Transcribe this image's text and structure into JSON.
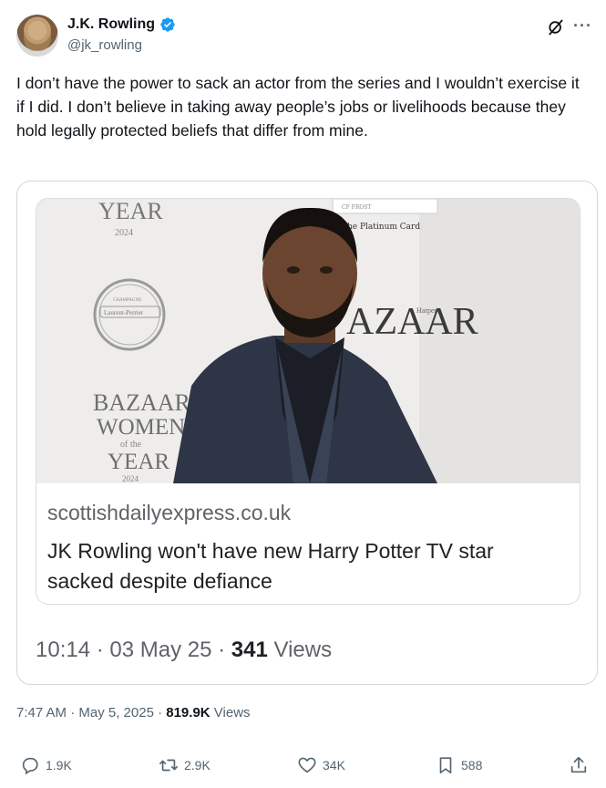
{
  "author": {
    "display_name": "J.K. Rowling",
    "handle": "@jk_rowling",
    "verified": true
  },
  "header_icons": [
    "grok-icon",
    "more-icon"
  ],
  "more_label": "···",
  "tweet": {
    "text": "I don’t have the power to sack an actor from the series and I wouldn’t exercise it if I did. I don’t believe in taking away people’s jobs or livelihoods because they hold legally protected beliefs that differ from mine."
  },
  "embedded": {
    "photo_text": {
      "year_top": "YEAR",
      "year_num_top": "2024",
      "seal_brand": "Laurent-Perrier",
      "seal_top": "CHAMPAGNE",
      "card_brand": "CF FROST",
      "platinum": "The Platinum Card",
      "bazaar_right": "AZAAR",
      "harpers_small": "Harper's",
      "bazaar_left": "BAZAAR",
      "women": "WOMEN",
      "of_the": "of the",
      "year_bottom": "YEAR",
      "year_num_bottom": "2024"
    },
    "link_domain": "scottishdailyexpress.co.uk",
    "link_title": "JK Rowling won't have new Harry Potter TV star sacked despite defiance",
    "inner_time": "10:14 · 03 May 25 · ",
    "inner_views_count": "341",
    "inner_views_label": " Views"
  },
  "meta": {
    "timestamp": "7:47 AM · May 5, 2025 · ",
    "views_count": "819.9K",
    "views_label": " Views"
  },
  "actions": {
    "replies": "1.9K",
    "reposts": "2.9K",
    "likes": "34K",
    "bookmarks": "588"
  },
  "colors": {
    "text_primary": "#0f1419",
    "text_secondary": "#536471",
    "verified_blue": "#1d9bf0",
    "border": "#cfd9de"
  }
}
